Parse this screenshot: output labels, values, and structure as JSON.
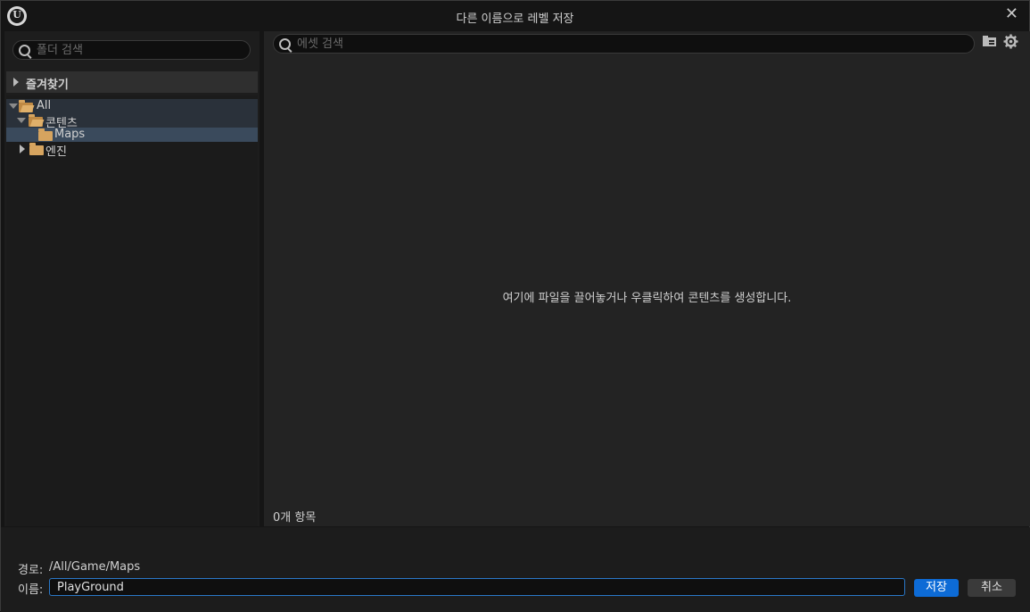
{
  "window": {
    "title": "다른 이름으로 레벨 저장",
    "logo_text": "U",
    "close_glyph": "✕"
  },
  "folder_panel": {
    "search_placeholder": "폴더 검색",
    "favorites_label": "즐겨찾기",
    "tree": [
      {
        "label": "All",
        "depth": 0,
        "expanded": true,
        "state": "highlight"
      },
      {
        "label": "콘텐츠",
        "depth": 1,
        "expanded": true,
        "state": "highlight"
      },
      {
        "label": "Maps",
        "depth": 2,
        "expanded": false,
        "state": "selected"
      },
      {
        "label": "엔진",
        "depth": 1,
        "expanded": false,
        "state": "normal"
      }
    ]
  },
  "asset_panel": {
    "search_placeholder": "에셋 검색",
    "empty_message": "여기에 파일을 끌어놓거나 우클릭하여 콘텐츠를 생성합니다.",
    "item_count": "0개 항목",
    "icons": [
      "folder-view-icon",
      "settings-gear-icon"
    ]
  },
  "footer": {
    "path_label": "경로:",
    "path_value": "/All/Game/Maps",
    "name_label": "이름:",
    "name_value": "PlayGround",
    "save_label": "저장",
    "cancel_label": "취소"
  },
  "colors": {
    "accent": "#0d6bd6",
    "selection": "#3a4a5c",
    "folder": "#d6a45f"
  }
}
